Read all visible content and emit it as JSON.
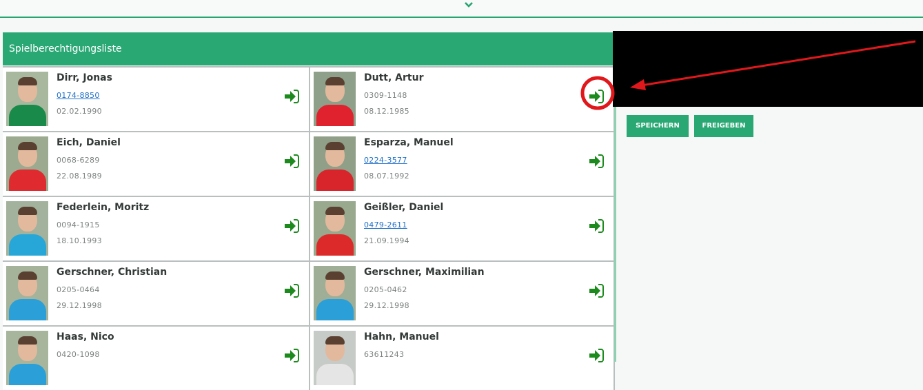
{
  "panel": {
    "title": "Spielberechtigungsliste"
  },
  "players": [
    {
      "name": "Dirr, Jonas",
      "number": "0174-8850",
      "number_is_link": true,
      "dob": "02.02.1990",
      "shirt": "#1a8a4a",
      "bg": "#a8b89e"
    },
    {
      "name": "Dutt, Artur",
      "number": "0309-1148",
      "number_is_link": false,
      "dob": "08.12.1985",
      "shirt": "#e0222e",
      "bg": "#8ea08a"
    },
    {
      "name": "Eich, Daniel",
      "number": "0068-6289",
      "number_is_link": false,
      "dob": "22.08.1989",
      "shirt": "#df2a2f",
      "bg": "#9caa8f"
    },
    {
      "name": "Esparza, Manuel",
      "number": "0224-3577",
      "number_is_link": true,
      "dob": "08.07.1992",
      "shirt": "#d8252c",
      "bg": "#8f9f88"
    },
    {
      "name": "Federlein, Moritz",
      "number": "0094-1915",
      "number_is_link": false,
      "dob": "18.10.1993",
      "shirt": "#27a7d8",
      "bg": "#a2b29c"
    },
    {
      "name": "Geißler, Daniel",
      "number": "0479-2611",
      "number_is_link": true,
      "dob": "21.09.1994",
      "shirt": "#dc2a2a",
      "bg": "#98a98e"
    },
    {
      "name": "Gerschner, Christian",
      "number": "0205-0464",
      "number_is_link": false,
      "dob": "29.12.1998",
      "shirt": "#2a9fd8",
      "bg": "#a5b39b"
    },
    {
      "name": "Gerschner, Maximilian",
      "number": "0205-0462",
      "number_is_link": false,
      "dob": "29.12.1998",
      "shirt": "#2a9fd8",
      "bg": "#9fae96"
    },
    {
      "name": "Haas, Nico",
      "number": "0420-1098",
      "number_is_link": false,
      "dob": "",
      "shirt": "#2a9fd8",
      "bg": "#a6b59c"
    },
    {
      "name": "Hahn, Manuel",
      "number": "63611243",
      "number_is_link": false,
      "dob": "",
      "shirt": "#e5e5e5",
      "bg": "#c7cbc7"
    }
  ],
  "buttons": {
    "save": "SPEICHERN",
    "release": "FREIGEBEN"
  },
  "colors": {
    "accent": "#2aa874",
    "action_icon": "#1c8a1c",
    "annotation": "#e0181b"
  }
}
